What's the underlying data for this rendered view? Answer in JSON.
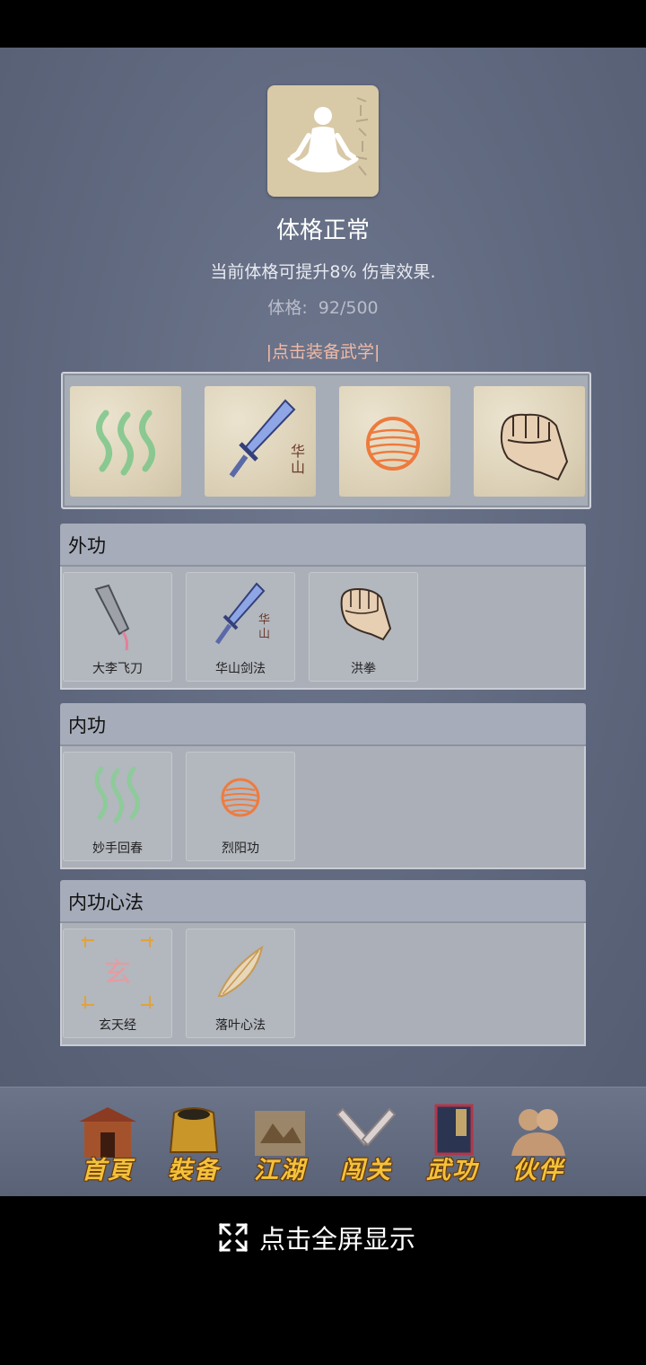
{
  "status": {
    "title": "体格正常",
    "description": "当前体格可提升8% 伤害效果.",
    "constitution_label": "体格:",
    "constitution_value": "92/500",
    "equip_hint": "|点击装备武学|"
  },
  "sections": {
    "outer": {
      "title": "外功",
      "skills": [
        {
          "name": "大李飞刀",
          "icon": "flying-knife-icon"
        },
        {
          "name": "华山剑法",
          "icon": "huashan-sword-icon"
        },
        {
          "name": "洪拳",
          "icon": "fist-icon"
        }
      ]
    },
    "inner": {
      "title": "内功",
      "skills": [
        {
          "name": "妙手回春",
          "icon": "healing-wave-icon"
        },
        {
          "name": "烈阳功",
          "icon": "sun-orb-icon"
        }
      ]
    },
    "mind": {
      "title": "内功心法",
      "skills": [
        {
          "name": "玄天经",
          "icon": "xuan-scripture-icon"
        },
        {
          "name": "落叶心法",
          "icon": "falling-leaf-icon"
        }
      ]
    }
  },
  "equipped": [
    "healing-wave-icon",
    "huashan-sword-icon",
    "sun-orb-icon",
    "fist-icon"
  ],
  "icon_text": {
    "huashan": "华\n山",
    "xuan": "玄"
  },
  "nav": [
    {
      "label": "首頁",
      "icon": "temple-icon"
    },
    {
      "label": "裝备",
      "icon": "armor-icon"
    },
    {
      "label": "江湖",
      "icon": "scroll-map-icon"
    },
    {
      "label": "闯关",
      "icon": "crossed-swords-icon"
    },
    {
      "label": "武功",
      "icon": "martial-book-icon"
    },
    {
      "label": "伙伴",
      "icon": "companions-icon"
    }
  ],
  "fullscreen": {
    "label": "点击全屏显示",
    "icon": "expand-icon"
  },
  "colors": {
    "background": "#656e84",
    "hint": "#f2b9a6",
    "nav_label": "#f3c23b"
  }
}
